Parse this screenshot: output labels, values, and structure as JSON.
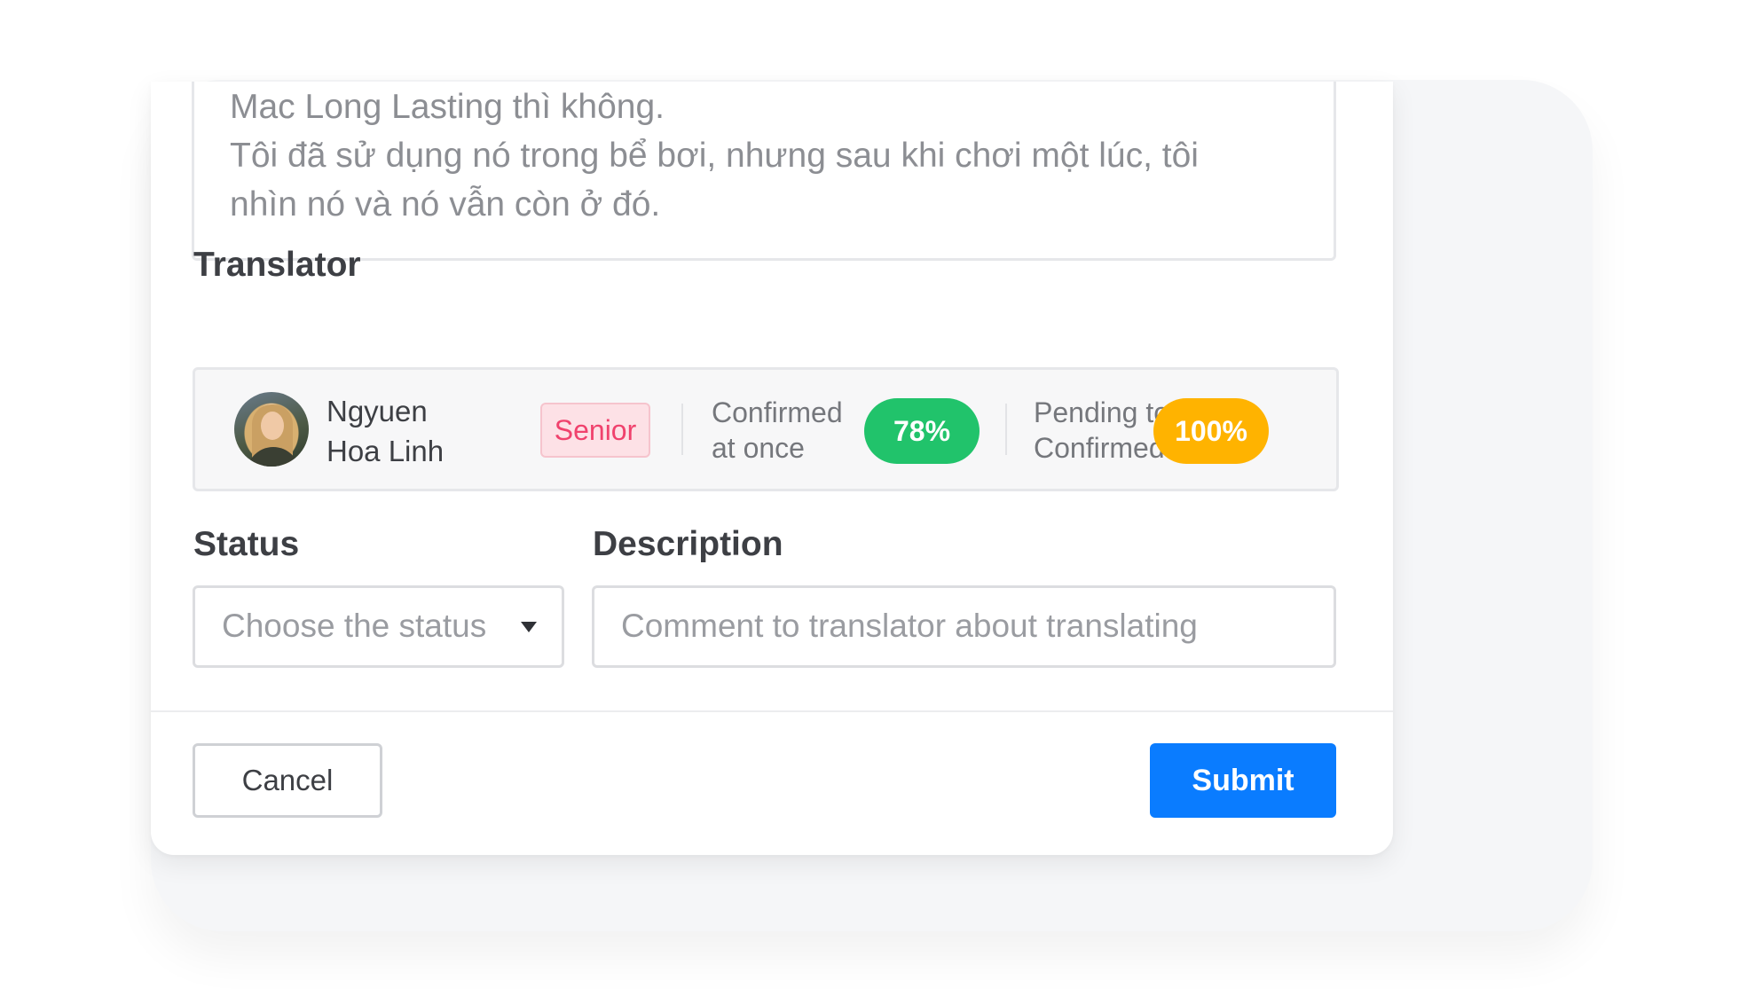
{
  "review": {
    "text": "Mac Long Lasting thì không.\nTôi đã sử dụng nó trong bể bơi, nhưng sau khi chơi một lúc, tôi\nnhìn nó và nó vẫn còn ở đó."
  },
  "translator": {
    "section_label": "Translator",
    "name_line1": "Ngyuen",
    "name_line2": "Hoa Linh",
    "level_badge": "Senior",
    "confirmed_label_line1": "Confirmed",
    "confirmed_label_line2": "at once",
    "confirmed_percent": "78%",
    "pending_label_line1": "Pending to",
    "pending_label_line2": "Confirmed",
    "pending_percent": "100%",
    "colors": {
      "confirmed": "#21c36b",
      "pending": "#ffb300",
      "senior": "#f0426d"
    }
  },
  "status": {
    "label": "Status",
    "placeholder": "Choose the status"
  },
  "description": {
    "label": "Description",
    "placeholder": "Comment to translator about translating"
  },
  "actions": {
    "cancel_label": "Cancel",
    "submit_label": "Submit",
    "submit_color": "#0a7cff"
  }
}
